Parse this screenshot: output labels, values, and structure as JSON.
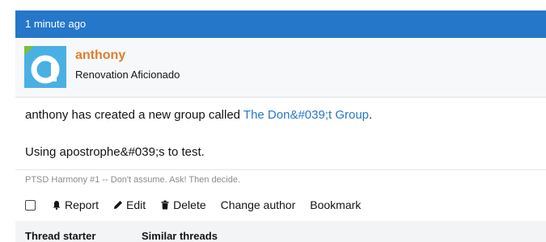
{
  "post": {
    "timestamp": "1 minute ago"
  },
  "author": {
    "username": "anthony",
    "title": "Renovation Aficionado",
    "avatar_letter": "a",
    "avatar_color": "#4ab0e4"
  },
  "message": {
    "line1_prefix": "anthony has created a new group called ",
    "group_link": "The Don&#039;t Group",
    "line1_suffix": ".",
    "line2": "Using apostrophe&#039;s to test."
  },
  "signature": "PTSD Harmony #1 -- Don't assume. Ask! Then decide.",
  "actions": {
    "report": "Report",
    "edit": "Edit",
    "delete": "Delete",
    "change_author": "Change author",
    "bookmark": "Bookmark"
  },
  "thread_info": {
    "starter_label": "Thread starter",
    "similar_label": "Similar threads"
  },
  "colors": {
    "header_bg": "#2577c9",
    "username": "#e07f2e",
    "link": "#2577c9"
  }
}
